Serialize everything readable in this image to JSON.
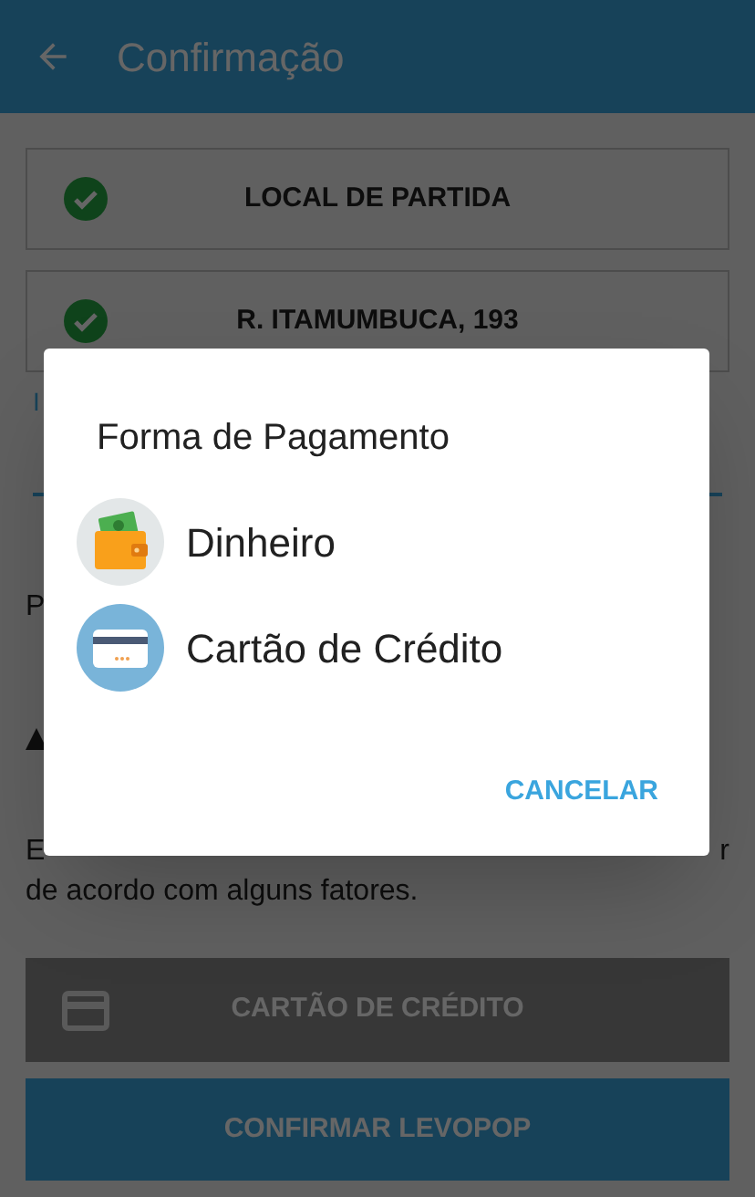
{
  "app_bar": {
    "title": "Confirmação"
  },
  "route": [
    {
      "label": "LOCAL DE PARTIDA",
      "confirmed": true
    },
    {
      "label": "R. ITAMUMBUCA, 193",
      "confirmed": true
    }
  ],
  "partial_texts": {
    "link_fragment": "I",
    "label_fragment": "P",
    "note_start": "E",
    "note_end": "r",
    "note_line": "de acordo com alguns fatores."
  },
  "payment_button": {
    "label": "CARTÃO DE CRÉDITO"
  },
  "confirm_button": {
    "label": "CONFIRMAR LEVOPOP"
  },
  "dialog": {
    "title": "Forma de Pagamento",
    "options": [
      {
        "kind": "cash",
        "label": "Dinheiro"
      },
      {
        "kind": "card",
        "label": "Cartão de Crédito"
      }
    ],
    "cancel": "CANCELAR"
  }
}
